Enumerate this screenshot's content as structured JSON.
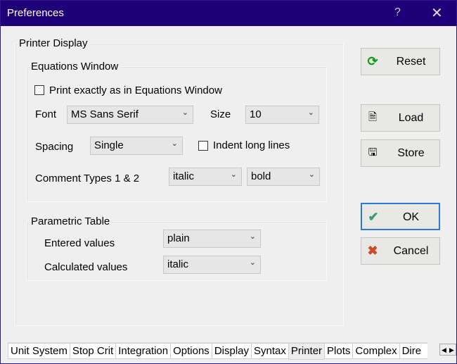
{
  "window": {
    "title": "Preferences",
    "help": "?",
    "close": "✕"
  },
  "printer_display": {
    "label": "Printer Display",
    "equations_window": {
      "label": "Equations Window",
      "print_exactly": {
        "label": "Print exactly as in Equations Window",
        "checked": false
      },
      "font_label": "Font",
      "font_value": "MS Sans Serif",
      "size_label": "Size",
      "size_value": "10",
      "spacing_label": "Spacing",
      "spacing_value": "Single",
      "indent": {
        "label": "Indent long lines",
        "checked": false
      },
      "comment_label": "Comment Types 1 & 2",
      "comment1_value": "italic",
      "comment2_value": "bold"
    },
    "parametric_table": {
      "label": "Parametric Table",
      "entered_label": "Entered values",
      "entered_value": "plain",
      "calculated_label": "Calculated values",
      "calculated_value": "italic"
    }
  },
  "buttons": {
    "reset": "Reset",
    "load": "Load",
    "store": "Store",
    "ok": "OK",
    "cancel": "Cancel"
  },
  "tabs": [
    "Unit System",
    "Stop Crit",
    "Integration",
    "Options",
    "Display",
    "Syntax",
    "Printer",
    "Plots",
    "Complex",
    "Dire"
  ],
  "active_tab": "Printer"
}
